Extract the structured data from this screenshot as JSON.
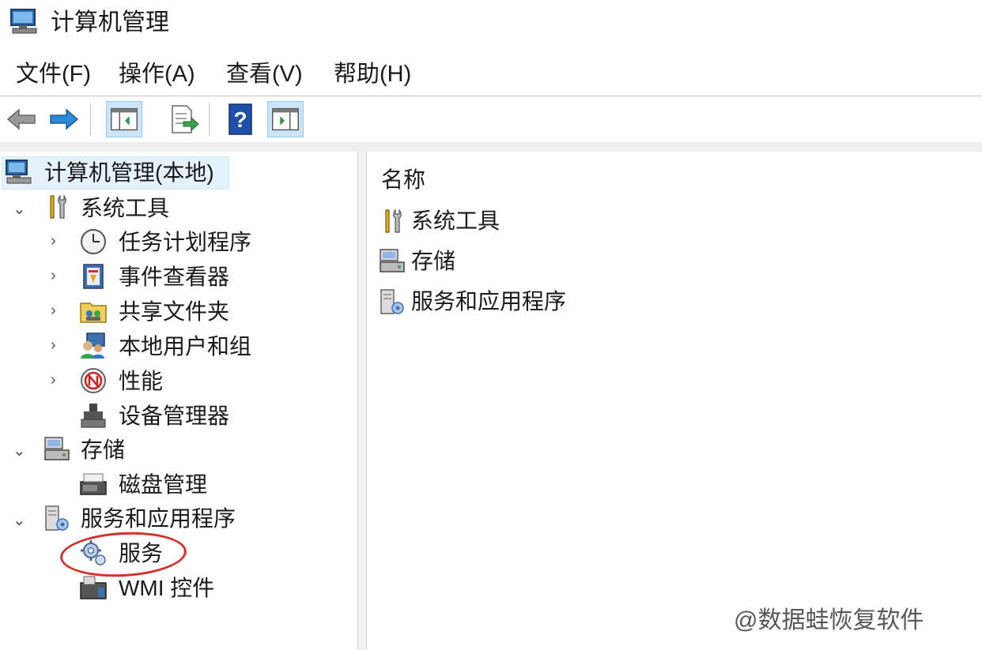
{
  "window": {
    "title": "计算机管理"
  },
  "menu": [
    {
      "label": "文件(F)"
    },
    {
      "label": "操作(A)"
    },
    {
      "label": "查看(V)"
    },
    {
      "label": "帮助(H)"
    }
  ],
  "toolbar": {
    "buttons": [
      "back-arrow-icon",
      "forward-arrow-icon",
      "show-console-tree-icon",
      "export-list-icon",
      "help-icon",
      "show-action-pane-icon"
    ]
  },
  "tree": {
    "root": "计算机管理(本地)",
    "system_tools": {
      "label": "系统工具",
      "children": [
        "任务计划程序",
        "事件查看器",
        "共享文件夹",
        "本地用户和组",
        "性能",
        "设备管理器"
      ]
    },
    "storage": {
      "label": "存储",
      "children": [
        "磁盘管理"
      ]
    },
    "services_apps": {
      "label": "服务和应用程序",
      "children": [
        "服务",
        "WMI 控件"
      ]
    }
  },
  "list": {
    "column_header": "名称",
    "items": [
      "系统工具",
      "存储",
      "服务和应用程序"
    ]
  },
  "watermark": "@数据蛙恢复软件",
  "colors": {
    "selection": "#e5f1fb",
    "annotation": "#d6302a",
    "arrow_blue": "#2b8ad8"
  }
}
